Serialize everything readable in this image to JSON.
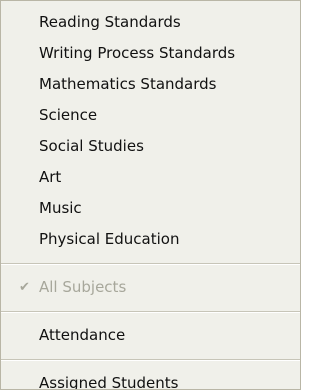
{
  "menu": {
    "items": [
      {
        "label": "Reading Standards"
      },
      {
        "label": "Writing Process Standards"
      },
      {
        "label": "Mathematics Standards"
      },
      {
        "label": "Science"
      },
      {
        "label": "Social Studies"
      },
      {
        "label": "Art"
      },
      {
        "label": "Music"
      },
      {
        "label": "Physical Education"
      }
    ],
    "all_subjects": {
      "label": "All Subjects",
      "checked": true,
      "enabled": false,
      "icon": "checkmark-icon"
    },
    "attendance": {
      "label": "Attendance"
    },
    "assigned_students": {
      "label": "Assigned Students"
    }
  }
}
